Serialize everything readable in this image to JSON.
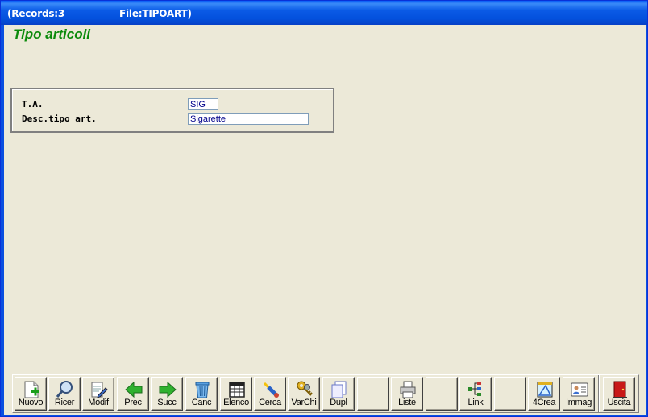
{
  "titlebar": {
    "records": "(Records:3",
    "file": "File:TIPOART)"
  },
  "page": {
    "heading": "Tipo articoli"
  },
  "form": {
    "ta_label": "T.A.",
    "ta_value": "SIG",
    "desc_label": "Desc.tipo art.",
    "desc_value": "Sigarette"
  },
  "toolbar": {
    "buttons": {
      "nuovo": "Nuovo",
      "ricer": "Ricer",
      "modif": "Modif",
      "prec": "Prec",
      "succ": "Succ",
      "canc": "Canc",
      "elenco": "Elenco",
      "cerca": "Cerca",
      "varchi": "VarChi",
      "dupl": "Dupl",
      "liste": "Liste",
      "link": "Link",
      "crea4": "4Crea",
      "immag": "Immag",
      "uscita": "Uscita"
    }
  },
  "colors": {
    "heading": "#0B8A0B",
    "field_text": "#00008B",
    "titlebar": "#0350DC",
    "background": "#ECE9D8"
  }
}
